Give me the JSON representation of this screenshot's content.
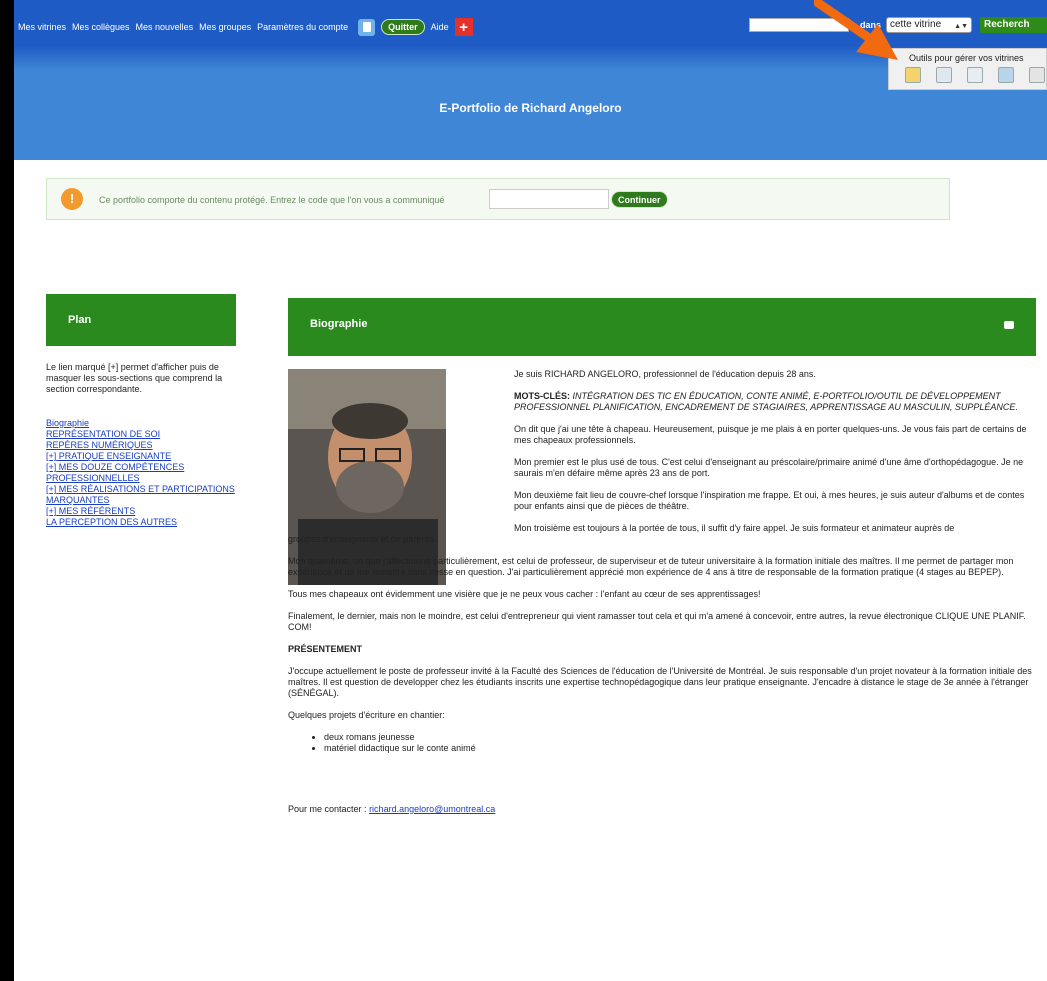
{
  "topbar": {
    "nav": [
      "Mes vitrines",
      "Mes collègues",
      "Mes nouvelles",
      "Mes groupes",
      "Paramètres du compte"
    ],
    "quit_label": "Quitter",
    "help_label": "Aide",
    "search_in_label": "dans",
    "search_scope": "cette vitrine",
    "search_button": "Recherch"
  },
  "tools": {
    "label": "Outils pour gérer vos vitrines",
    "icons": [
      "edit-icon",
      "preview-icon",
      "copy-icon",
      "export-icon",
      "delete-icon"
    ]
  },
  "banner": {
    "title": "E-Portfolio de Richard Angeloro"
  },
  "notice": {
    "text": "Ce portfolio comporte du contenu protégé. Entrez le code que l'on vous a communiqué",
    "button": "Continuer"
  },
  "plan": {
    "title": "Plan",
    "description": "Le lien marqué [+] permet d'afficher puis de masquer les sous-sections que comprend la section correspondante.",
    "links": [
      {
        "prefix": "",
        "label": "Biographie"
      },
      {
        "prefix": "",
        "label": "REPRÉSENTATION DE SOI"
      },
      {
        "prefix": "",
        "label": "REPÈRES NUMÉRIQUES"
      },
      {
        "prefix": "[+]",
        "label": "PRATIQUE ENSEIGNANTE"
      },
      {
        "prefix": "[+]",
        "label": "MES DOUZE COMPÉTENCES PROFESSIONNELLES"
      },
      {
        "prefix": "[+]",
        "label": "MES RÉALISATIONS ET PARTICIPATIONS MARQUANTES"
      },
      {
        "prefix": "[+]",
        "label": "MES RÉFÉRENTS"
      },
      {
        "prefix": "",
        "label": "LA PERCEPTION DES AUTRES"
      }
    ]
  },
  "bio": {
    "title": "Biographie",
    "intro": "Je suis RICHARD ANGELORO, professionnel de l'éducation depuis 28 ans.",
    "keywords_label": "MOTS-CLÉS:",
    "keywords": "INTÉGRATION DES TIC EN ÉDUCATION, CONTE ANIMÉ, E-PORTFOLIO/OUTIL DE DÉVELOPPEMENT PROFESSIONNEL PLANIFICATION, ENCADREMENT DE STAGIAIRES, APPRENTISSAGE AU MASCULIN, SUPPLÉANCE.",
    "p1": "On dit que j'ai une tête à chapeau. Heureusement, puisque je me plais à en porter quelques-uns. Je vous fais part de certains de mes chapeaux professionnels.",
    "p2": "Mon premier est le plus usé de tous. C'est celui d'enseignant au préscolaire/primaire animé d'une âme d'orthopédagogue. Je ne saurais m'en défaire même après 23 ans de port.",
    "p3": "Mon deuxième fait lieu de couvre-chef lorsque l'inspiration me frappe. Et oui, à mes heures, je suis auteur d'albums et de contes pour enfants ainsi que de pièces de théâtre.",
    "p4a": "Mon troisième est toujours à la portée de tous, il suffit d'y faire appel. Je suis formateur et animateur auprès de",
    "p4b": "groupes d'enseignants et de parents.",
    "p5": "Mon quatrième, un que j'affectionne particulièrement, est celui de professeur, de superviseur et de tuteur universitaire à la formation initiale des maîtres. Il me permet de partager mon expérience et de me remettre sans cesse en question. J'ai particulièrement apprécié mon expérience de 4 ans à titre de responsable de la formation pratique (4 stages au BEPEP).",
    "p6": "Tous mes chapeaux ont évidemment une visière que je ne peux vous cacher : l'enfant au cœur de ses apprentissages!",
    "p7": "Finalement, le dernier, mais non le moindre, est celui d'entrepreneur qui vient ramasser tout cela et qui m'a amené à concevoir, entre autres, la revue électronique CLIQUE UNE PLANIF. COM!",
    "present_title": "PRÉSENTEMENT",
    "p8": "J'occupe actuellement le poste de professeur invité à la Faculté des Sciences de l'éducation de l'Université de Montréal. Je suis responsable d'un projet novateur à la formation initiale des maîtres. Il est question de developper chez les étudiants inscrits une expertise technopédagogique dans leur pratique enseignante. J'encadre à distance le stage de 3e année à l'étranger (SÉNÉGAL).",
    "projects_label": "Quelques projets d'écriture en chantier:",
    "projects": [
      "deux romans jeunesse",
      "matériel didactique sur le conte animé"
    ],
    "contact_label": "Pour me contacter :",
    "contact_email": "richard.angeloro@umontreal.ca"
  }
}
